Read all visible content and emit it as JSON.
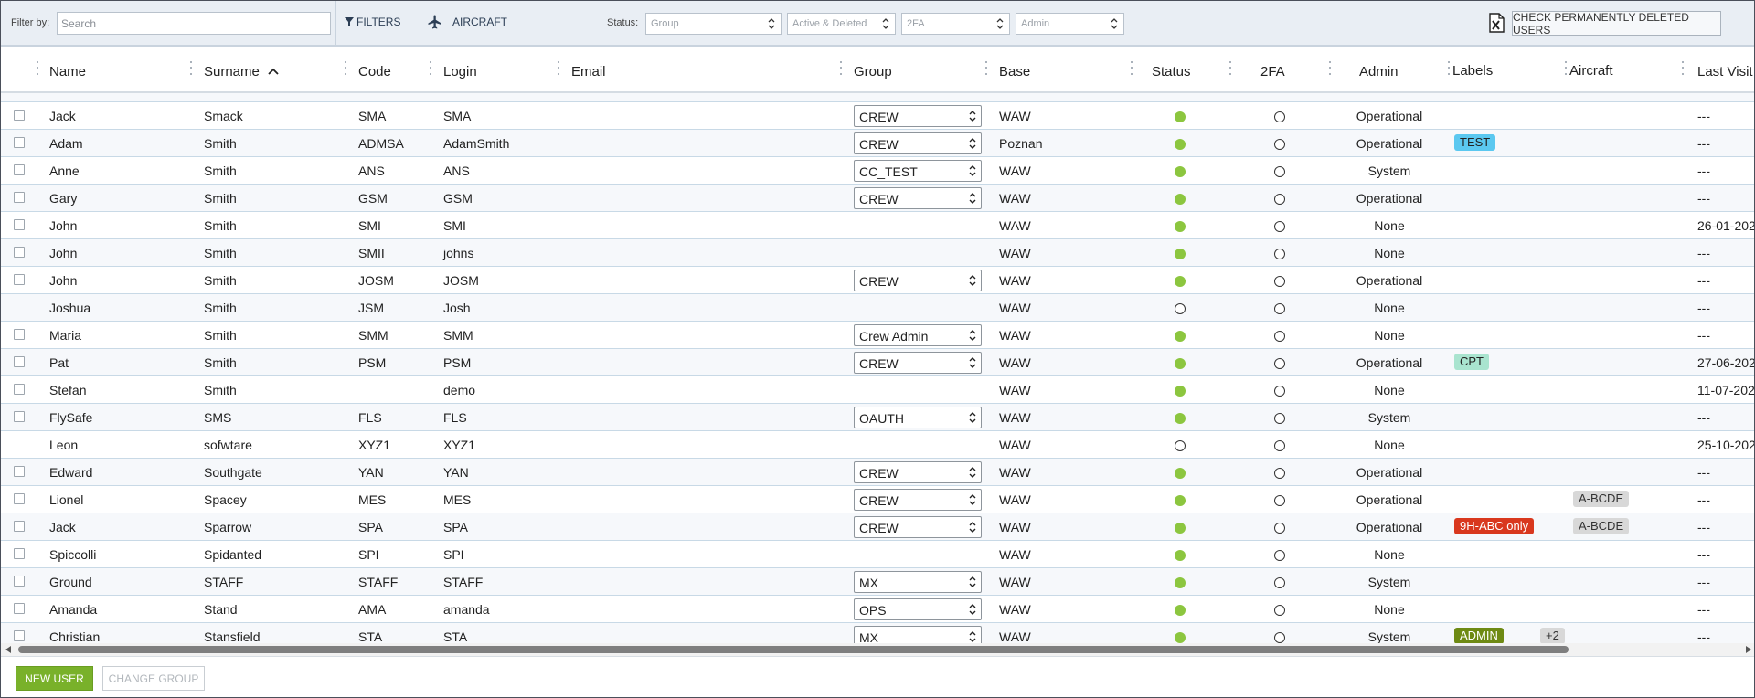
{
  "filterbar": {
    "filter_by_label": "Filter by:",
    "search_placeholder": "Search",
    "filters_label": "FILTERS",
    "aircraft_label": "AIRCRAFT",
    "status_label": "Status:",
    "selects": [
      "Group",
      "Active & Deleted",
      "2FA",
      "Admin"
    ],
    "check_deleted_label": "CHECK PERMANENTLY DELETED USERS"
  },
  "columns": {
    "name": "Name",
    "surname": "Surname",
    "code": "Code",
    "login": "Login",
    "email": "Email",
    "group": "Group",
    "base": "Base",
    "status": "Status",
    "twofa": "2FA",
    "admin": "Admin",
    "labels": "Labels",
    "aircraft": "Aircraft",
    "last_visit": "Last Visit"
  },
  "rows": [
    {
      "cb": true,
      "name": "Jack",
      "surname": "Smack",
      "code": "SMA",
      "login": "SMA",
      "group": "CREW",
      "base": "WAW",
      "active": true,
      "admin": "Operational",
      "label": "",
      "label_color": "",
      "aircraft": "",
      "extra": "",
      "last": "---"
    },
    {
      "cb": true,
      "name": "Adam",
      "surname": "Smith",
      "code": "ADMSA",
      "login": "AdamSmith",
      "group": "CREW",
      "base": "Poznan",
      "active": true,
      "admin": "Operational",
      "label": "TEST",
      "label_color": "#5bc8f0",
      "aircraft": "",
      "extra": "",
      "last": "---"
    },
    {
      "cb": true,
      "name": "Anne",
      "surname": "Smith",
      "code": "ANS",
      "login": "ANS",
      "group": "CC_TEST",
      "base": "WAW",
      "active": true,
      "admin": "System",
      "label": "",
      "label_color": "",
      "aircraft": "",
      "extra": "",
      "last": "---"
    },
    {
      "cb": true,
      "name": "Gary",
      "surname": "Smith",
      "code": "GSM",
      "login": "GSM",
      "group": "CREW",
      "base": "WAW",
      "active": true,
      "admin": "Operational",
      "label": "",
      "label_color": "",
      "aircraft": "",
      "extra": "",
      "last": "---"
    },
    {
      "cb": true,
      "name": "John",
      "surname": "Smith",
      "code": "SMI",
      "login": "SMI",
      "group": "",
      "base": "WAW",
      "active": true,
      "admin": "None",
      "label": "",
      "label_color": "",
      "aircraft": "",
      "extra": "",
      "last": "26-01-202"
    },
    {
      "cb": true,
      "name": "John",
      "surname": "Smith",
      "code": "SMII",
      "login": "johns",
      "group": "",
      "base": "WAW",
      "active": true,
      "admin": "None",
      "label": "",
      "label_color": "",
      "aircraft": "",
      "extra": "",
      "last": "---"
    },
    {
      "cb": true,
      "name": "John",
      "surname": "Smith",
      "code": "JOSM",
      "login": "JOSM",
      "group": "CREW",
      "base": "WAW",
      "active": true,
      "admin": "Operational",
      "label": "",
      "label_color": "",
      "aircraft": "",
      "extra": "",
      "last": "---"
    },
    {
      "cb": false,
      "name": "Joshua",
      "surname": "Smith",
      "code": "JSM",
      "login": "Josh",
      "group": "",
      "base": "WAW",
      "active": false,
      "admin": "None",
      "label": "",
      "label_color": "",
      "aircraft": "",
      "extra": "",
      "last": "---"
    },
    {
      "cb": true,
      "name": "Maria",
      "surname": "Smith",
      "code": "SMM",
      "login": "SMM",
      "group": "Crew Admin",
      "base": "WAW",
      "active": true,
      "admin": "None",
      "label": "",
      "label_color": "",
      "aircraft": "",
      "extra": "",
      "last": "---"
    },
    {
      "cb": true,
      "name": "Pat",
      "surname": "Smith",
      "code": "PSM",
      "login": "PSM",
      "group": "CREW",
      "base": "WAW",
      "active": true,
      "admin": "Operational",
      "label": "CPT",
      "label_color": "#a9e4cf",
      "aircraft": "",
      "extra": "",
      "last": "27-06-202"
    },
    {
      "cb": true,
      "name": "Stefan",
      "surname": "Smith",
      "code": "",
      "login": "demo",
      "group": "",
      "base": "WAW",
      "active": true,
      "admin": "None",
      "label": "",
      "label_color": "",
      "aircraft": "",
      "extra": "",
      "last": "11-07-202"
    },
    {
      "cb": true,
      "name": "FlySafe",
      "surname": "SMS",
      "code": "FLS",
      "login": "FLS",
      "group": "OAUTH",
      "base": "WAW",
      "active": true,
      "admin": "System",
      "label": "",
      "label_color": "",
      "aircraft": "",
      "extra": "",
      "last": "---"
    },
    {
      "cb": false,
      "name": "Leon",
      "surname": "sofwtare",
      "code": "XYZ1",
      "login": "XYZ1",
      "group": "",
      "base": "WAW",
      "active": false,
      "admin": "None",
      "label": "",
      "label_color": "",
      "aircraft": "",
      "extra": "",
      "last": "25-10-202"
    },
    {
      "cb": true,
      "name": "Edward",
      "surname": "Southgate",
      "code": "YAN",
      "login": "YAN",
      "group": "CREW",
      "base": "WAW",
      "active": true,
      "admin": "Operational",
      "label": "",
      "label_color": "",
      "aircraft": "",
      "extra": "",
      "last": "---"
    },
    {
      "cb": true,
      "name": "Lionel",
      "surname": "Spacey",
      "code": "MES",
      "login": "MES",
      "group": "CREW",
      "base": "WAW",
      "active": true,
      "admin": "Operational",
      "label": "",
      "label_color": "",
      "aircraft": "A-BCDE",
      "extra": "",
      "last": "---"
    },
    {
      "cb": true,
      "name": "Jack",
      "surname": "Sparrow",
      "code": "SPA",
      "login": "SPA",
      "group": "CREW",
      "base": "WAW",
      "active": true,
      "admin": "Operational",
      "label": "9H-ABC only",
      "label_color": "#d9381e",
      "aircraft": "A-BCDE",
      "extra": "",
      "last": "---"
    },
    {
      "cb": true,
      "name": "Spiccolli",
      "surname": "Spidanted",
      "code": "SPI",
      "login": "SPI",
      "group": "",
      "base": "WAW",
      "active": true,
      "admin": "None",
      "label": "",
      "label_color": "",
      "aircraft": "",
      "extra": "",
      "last": "---"
    },
    {
      "cb": true,
      "name": "Ground",
      "surname": "STAFF",
      "code": "STAFF",
      "login": "STAFF",
      "group": "MX",
      "base": "WAW",
      "active": true,
      "admin": "System",
      "label": "",
      "label_color": "",
      "aircraft": "",
      "extra": "",
      "last": "---"
    },
    {
      "cb": true,
      "name": "Amanda",
      "surname": "Stand",
      "code": "AMA",
      "login": "amanda",
      "group": "OPS",
      "base": "WAW",
      "active": true,
      "admin": "None",
      "label": "",
      "label_color": "",
      "aircraft": "",
      "extra": "",
      "last": "---"
    },
    {
      "cb": true,
      "name": "Christian",
      "surname": "Stansfield",
      "code": "STA",
      "login": "STA",
      "group": "MX",
      "base": "WAW",
      "active": true,
      "admin": "System",
      "label": "ADMIN",
      "label_color": "#6e8a14",
      "aircraft": "",
      "extra": "+2",
      "last": "---"
    }
  ],
  "footer": {
    "new_user_label": "NEW USER",
    "change_group_label": "CHANGE GROUP"
  }
}
